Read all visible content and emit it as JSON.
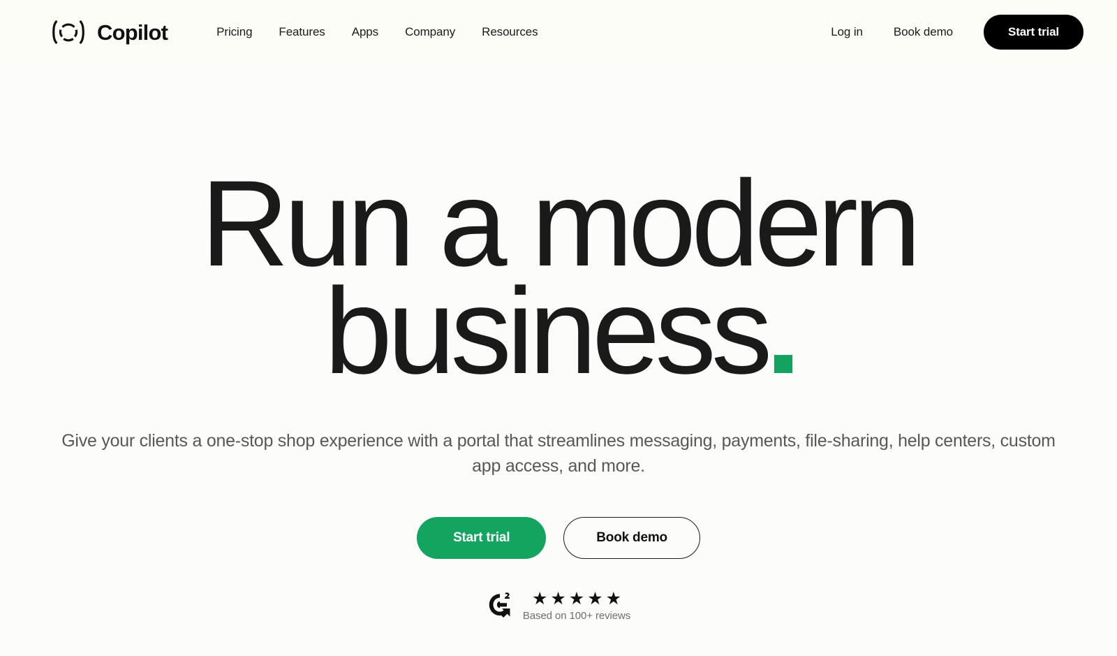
{
  "brand": {
    "name": "Copilot",
    "logo_icon": "copilot-dashed-circle-parens-icon"
  },
  "header": {
    "nav": [
      {
        "label": "Pricing"
      },
      {
        "label": "Features"
      },
      {
        "label": "Apps"
      },
      {
        "label": "Company"
      },
      {
        "label": "Resources"
      }
    ],
    "login_label": "Log in",
    "book_demo_label": "Book demo",
    "start_trial_label": "Start trial"
  },
  "hero": {
    "headline_line1": "Run a modern",
    "headline_line2": "business",
    "headline_accent": "green-square-period",
    "subtitle": "Give your clients a one-stop shop experience with a portal that streamlines messaging, payments, file-sharing, help centers, custom app access, and more.",
    "primary_cta": "Start trial",
    "secondary_cta": "Book demo"
  },
  "rating": {
    "source_icon": "g2-logo-icon",
    "stars_filled": 5,
    "star_glyph": "★",
    "reviews_note": "Based on 100+ reviews"
  },
  "colors": {
    "background": "#FCFCFA",
    "header_background": "#FDFDF7",
    "text_primary": "#1A1A1A",
    "text_muted": "#585858",
    "accent_green": "#13A45F",
    "dark_button": "#000000"
  }
}
